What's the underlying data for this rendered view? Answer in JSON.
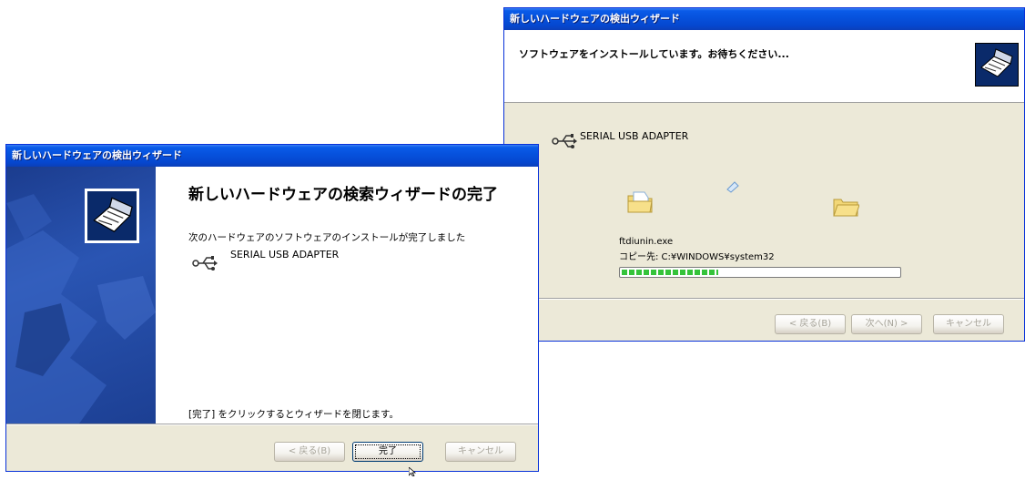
{
  "progress_window": {
    "title": "新しいハードウェアの検出ウィザード",
    "header_title": "ソフトウェアをインストールしています。お待ちください...",
    "device_name": "SERIAL USB ADAPTER",
    "file_name": "ftdiunin.exe",
    "copy_destination": "コピー先: C:¥WINDOWS¥system32",
    "progress": 0.35,
    "buttons": {
      "back": "< 戻る(B)",
      "next": "次へ(N) >",
      "cancel": "キャンセル"
    }
  },
  "completion_window": {
    "title": "新しいハードウェアの検出ウィザード",
    "heading": "新しいハードウェアの検索ウィザードの完了",
    "message": "次のハードウェアのソフトウェアのインストールが完了しました",
    "device_name": "SERIAL USB ADAPTER",
    "footer_message": "[完了] をクリックするとウィザードを閉じます。",
    "buttons": {
      "back": "< 戻る(B)",
      "finish": "完了",
      "cancel": "キャンセル"
    }
  },
  "colors": {
    "titlebar": "#0651dc",
    "dialog_face": "#ece9d8",
    "progress_green": "#35c33a",
    "left_panel": "#2a55b3"
  },
  "icons": {
    "usb": "usb-icon",
    "wizard": "hardware-wizard-icon",
    "folder": "folder-icon",
    "file": "file-icon"
  }
}
